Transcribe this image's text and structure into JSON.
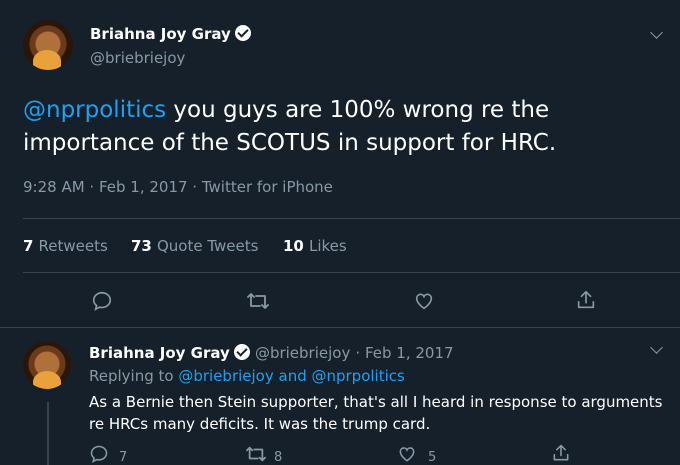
{
  "tweet": {
    "author_name": "Briahna Joy Gray",
    "author_handle": "@briebriejoy",
    "mention": "@nprpolitics",
    "text": " you guys are 100% wrong re the importance of the SCOTUS in support for HRC.",
    "timestamp": "9:28 AM · Feb 1, 2017 · Twitter for iPhone",
    "stats": {
      "retweets_count": "7",
      "retweets_label": "Retweets",
      "quotes_count": "73",
      "quotes_label": "Quote Tweets",
      "likes_count": "10",
      "likes_label": "Likes"
    }
  },
  "reply": {
    "author_name": "Briahna Joy Gray",
    "author_handle": "@briebriejoy",
    "date": "· Feb 1, 2017",
    "replying_prefix": "Replying to ",
    "replying_to": "@briebriejoy and @nprpolitics",
    "text": "As a Bernie then Stein supporter, that's all I heard in response to arguments re HRCs many deficits. It was the trump card.",
    "reply_count": "7",
    "retweet_count": "8",
    "like_count": "5"
  },
  "icons": [
    "verified-icon",
    "chevron-down-icon",
    "reply-icon",
    "retweet-icon",
    "like-icon",
    "share-icon"
  ],
  "colors": {
    "background": "#15202b",
    "accent": "#1da1f2",
    "muted": "#8899a6",
    "divider": "#38444d"
  }
}
